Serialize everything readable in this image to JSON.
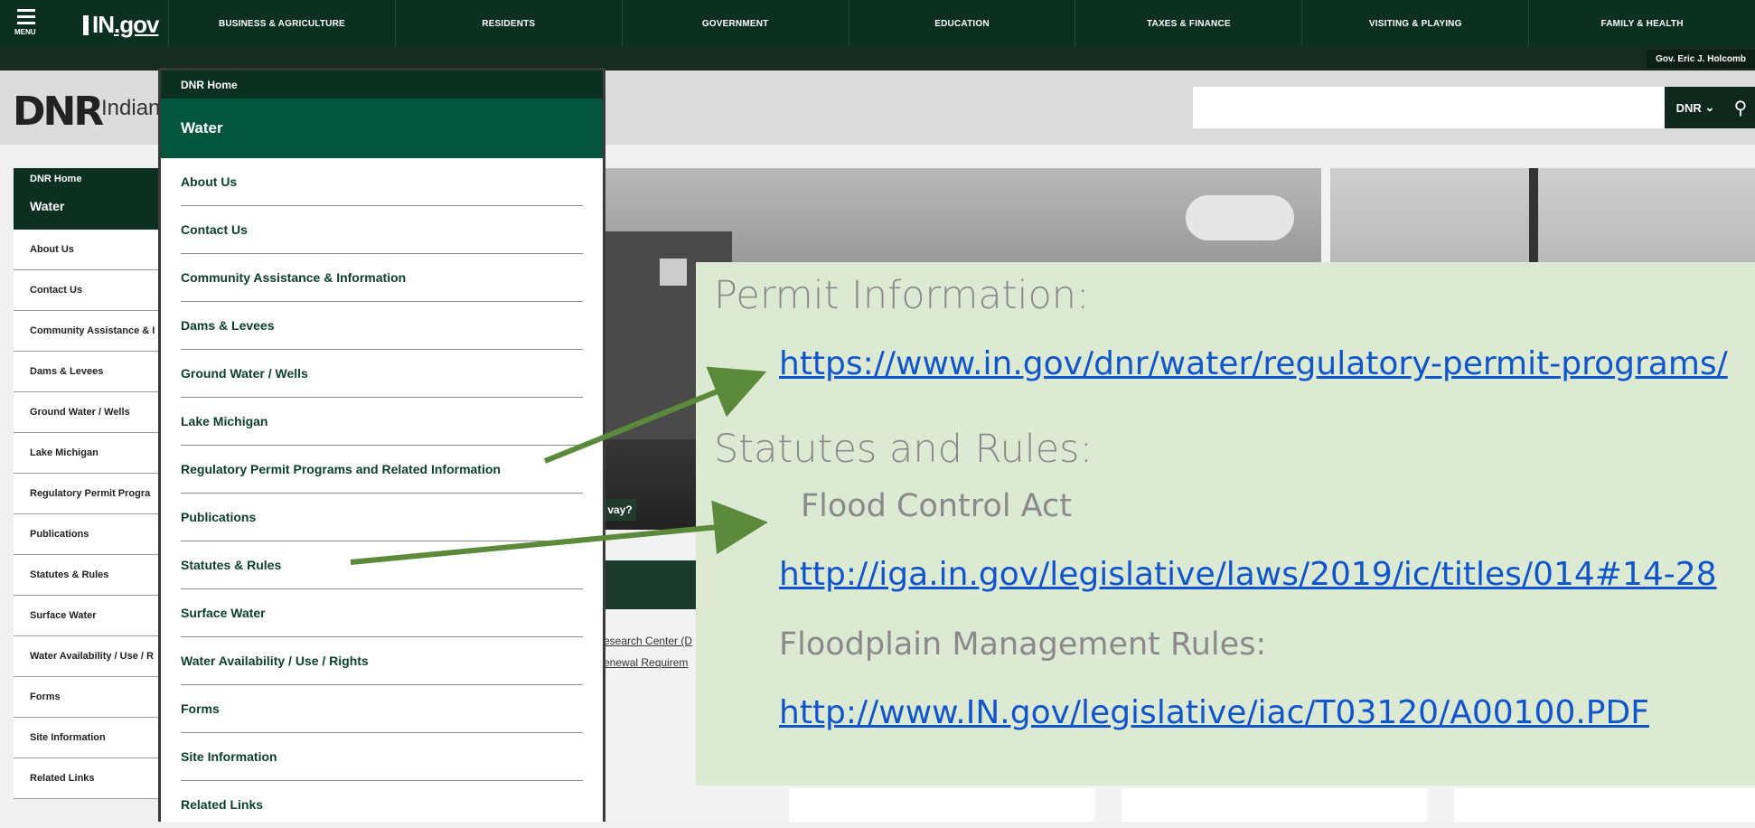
{
  "topnav": {
    "menu_label": "MENU",
    "logo_text_a": "IN",
    "logo_text_b": ".gov",
    "items": [
      "Business & Agriculture",
      "Residents",
      "Government",
      "Education",
      "Taxes & Finance",
      "Visiting & Playing",
      "Family & Health"
    ],
    "governor": "Gov. Eric J. Holcomb"
  },
  "header": {
    "logo": "DNR",
    "subtitle": "Indian",
    "search_placeholder": "",
    "scope_label": "DNR",
    "search_icon": "search-icon"
  },
  "sidebar": {
    "home": "DNR Home",
    "title": "Water",
    "items": [
      "About Us",
      "Contact Us",
      "Community Assistance & I",
      "Dams & Levees",
      "Ground Water / Wells",
      "Lake Michigan",
      "Regulatory Permit Progra",
      "Publications",
      "Statutes & Rules",
      "Surface Water",
      "Water Availability / Use / R",
      "Forms",
      "Site Information",
      "Related Links"
    ]
  },
  "dropdown": {
    "home": "DNR Home",
    "title": "Water",
    "items": [
      "About Us",
      "Contact Us",
      "Community Assistance & Information",
      "Dams & Levees",
      "Ground Water / Wells",
      "Lake Michigan",
      "Regulatory Permit Programs and Related Information",
      "Publications",
      "Statutes & Rules",
      "Surface Water",
      "Water Availability / Use / Rights",
      "Forms",
      "Site Information",
      "Related Links"
    ]
  },
  "content": {
    "cut_question": "vay?",
    "cut_link_1": "esearch Center (D",
    "cut_link_2": "enewal Requirem"
  },
  "callout": {
    "permit_heading": "Permit Information:",
    "permit_url": "https://www.in.gov/dnr/water/regulatory-permit-programs/",
    "statutes_heading": "Statutes and Rules:",
    "flood_act": "Flood Control Act",
    "flood_act_url": "http://iga.in.gov/legislative/laws/2019/ic/titles/014#14-28",
    "floodplain": "Floodplain Management Rules:",
    "floodplain_url": "http://www.IN.gov/legislative/iac/T03120/A00100.PDF"
  },
  "colors": {
    "nav_dark": "#0b2f21",
    "dropdown_title": "#03563b",
    "callout_bg": "#dce9d3",
    "arrow": "#5a8a3a",
    "link": "#1155cc"
  }
}
